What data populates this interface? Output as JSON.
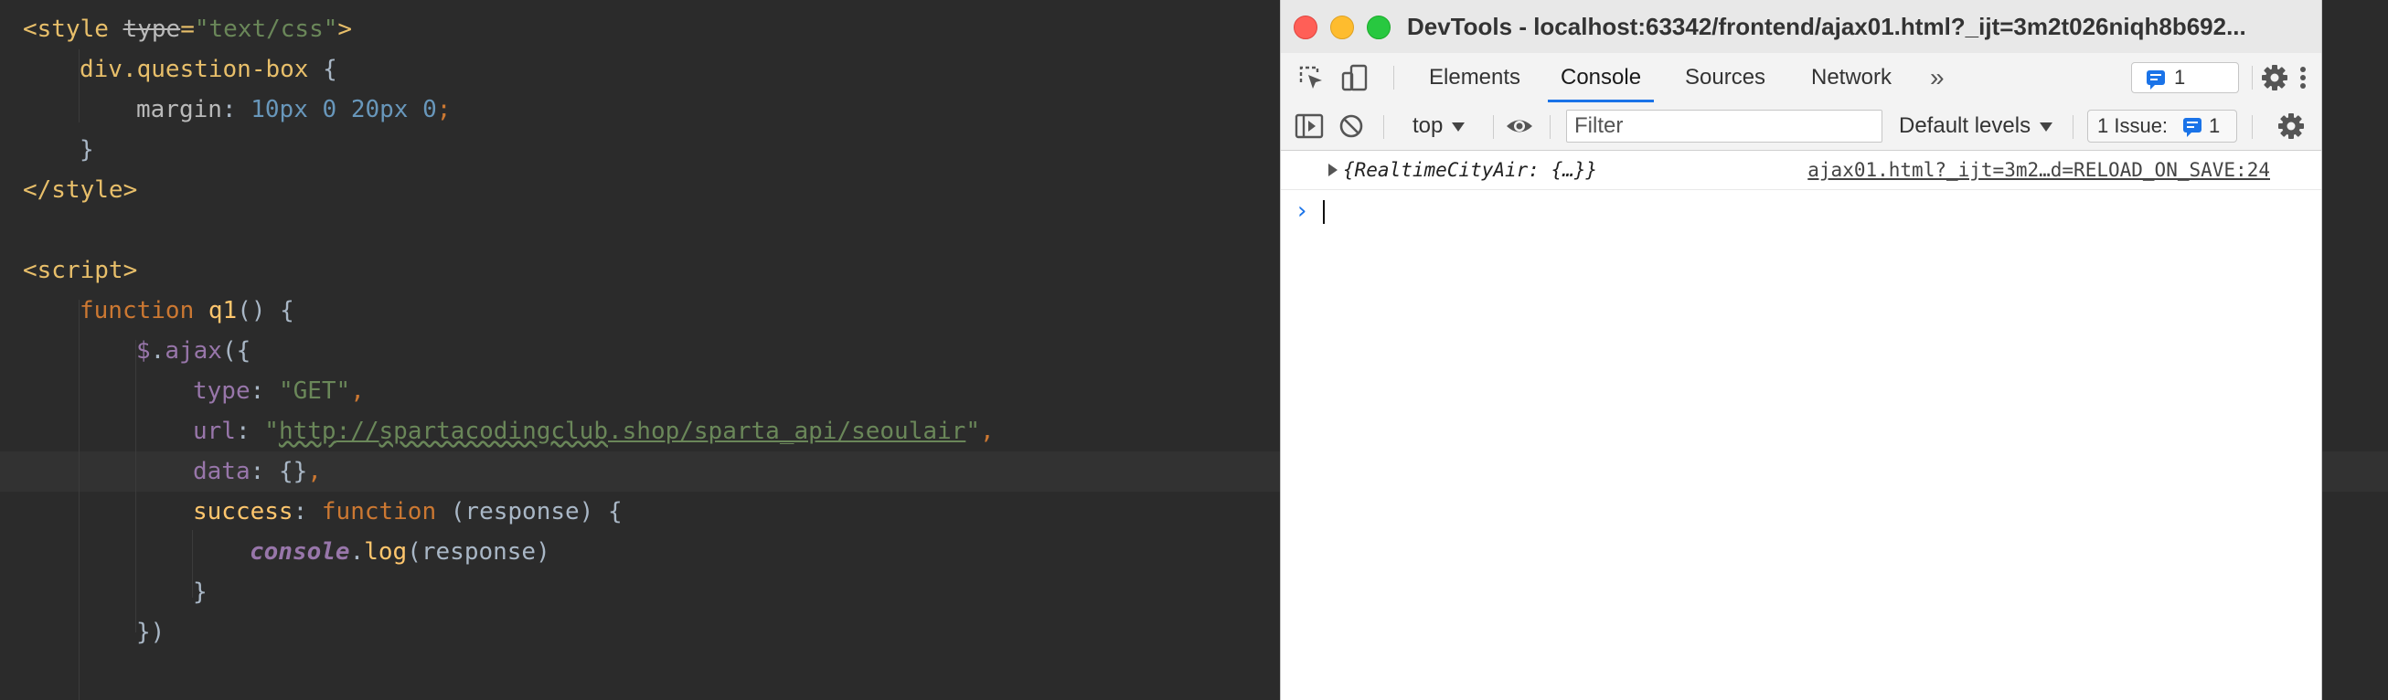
{
  "editor": {
    "lines": {
      "l1": {
        "open": "<style ",
        "attr": "type",
        "eq": "=",
        "val": "\"text/css\"",
        "close": ">"
      },
      "l2": {
        "selector": "div.question-box",
        "brace": " {"
      },
      "l3": {
        "prop": "margin",
        "colon": ": ",
        "v1": "10px",
        "v2": " 0 ",
        "v3": "20px",
        "v4": " 0",
        "semi": ";"
      },
      "l4": {
        "text": "}"
      },
      "l5": {
        "text": "</style>"
      },
      "l7": {
        "text": "<script>"
      },
      "l8": {
        "kw": "function",
        "name": " q1",
        "rest": "() {"
      },
      "l9": {
        "jq": "$",
        "dot": ".",
        "method": "ajax",
        "rest": "({"
      },
      "l10": {
        "key": "type",
        "colon": ": ",
        "val": "\"GET\"",
        "comma": ","
      },
      "l11": {
        "key": "url",
        "colon": ": ",
        "q1": "\"",
        "url_a": "http",
        "url_b": "://",
        "url_c": "spartacodingclub",
        "url_d": ".shop/sparta_api/seoulair",
        "q2": "\"",
        "comma": ","
      },
      "l12": {
        "key": "data",
        "colon": ": ",
        "val": "{}",
        "comma": ","
      },
      "l13": {
        "key": "success",
        "colon": ": ",
        "kw": "function",
        "rest": " (response) {"
      },
      "l14": {
        "obj": "console",
        "dot": ".",
        "method": "log",
        "rest": "(response)"
      },
      "l15": {
        "text": "}"
      },
      "l16": {
        "text": "})"
      }
    }
  },
  "devtools": {
    "title": "DevTools - localhost:63342/frontend/ajax01.html?_ijt=3m2t026niqh8b692...",
    "tabs": [
      {
        "label": "Elements"
      },
      {
        "label": "Console"
      },
      {
        "label": "Sources"
      },
      {
        "label": "Network"
      }
    ],
    "more_tabs": "»",
    "issue_count": "1",
    "toolbar": {
      "context": "top",
      "filter_placeholder": "Filter",
      "levels": "Default levels",
      "issues_label": "1 Issue:",
      "issues_count": "1"
    },
    "console": {
      "log_value": "{RealtimeCityAir: {…}}",
      "log_source": "ajax01.html?_ijt=3m2…d=RELOAD_ON_SAVE:24",
      "prompt": "›"
    }
  },
  "colors": {
    "accent": "#1a73e8",
    "editor_bg": "#2b2b2b",
    "close": "#ff5f57",
    "minimize": "#febc2e",
    "maximize": "#28c840"
  }
}
